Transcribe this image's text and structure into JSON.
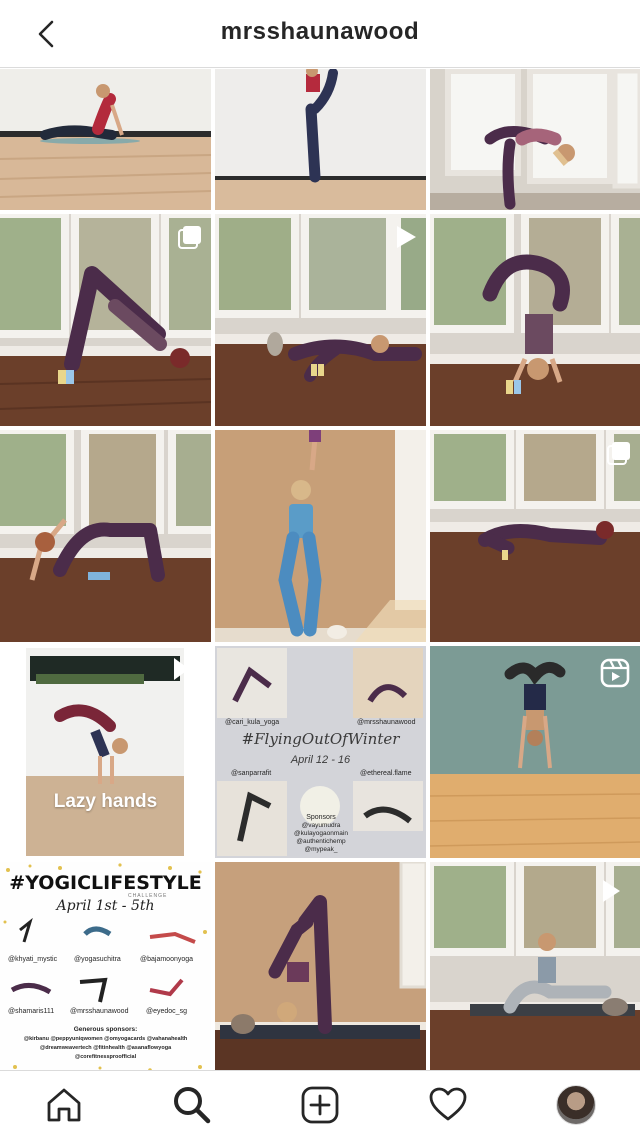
{
  "header": {
    "username": "mrsshaunawood"
  },
  "posts": [
    {
      "alt": "post-1"
    },
    {
      "alt": "post-2"
    },
    {
      "alt": "post-3"
    },
    {
      "alt": "post-4",
      "badge": "carousel"
    },
    {
      "alt": "post-5",
      "badge": "video"
    },
    {
      "alt": "post-6"
    },
    {
      "alt": "post-7"
    },
    {
      "alt": "post-8"
    },
    {
      "alt": "post-9",
      "badge": "carousel"
    },
    {
      "alt": "post-10",
      "badge": "video"
    },
    {
      "alt": "post-11"
    },
    {
      "alt": "post-12",
      "badge": "reel"
    },
    {
      "alt": "post-13"
    },
    {
      "alt": "post-14"
    },
    {
      "alt": "post-15",
      "badge": "video"
    }
  ],
  "post10": {
    "caption": "Lazy hands"
  },
  "post11": {
    "hashtag": "#FlyingOutOfWinter",
    "dates": "April 12 - 16",
    "handles": [
      "@cari_kula_yoga",
      "@mrsshaunawood",
      "@sanparrafit",
      "@ethereal.flame"
    ],
    "sponsors_title": "Sponsors",
    "sponsors": [
      "@vayumudra",
      "@kulayogaonmain",
      "@authentichemp",
      "@mypeak_"
    ]
  },
  "post13": {
    "title": "#YOGICLIFESTYLE",
    "subtitle": "CHALLENGE",
    "dates": "April 1st - 5th",
    "handles": [
      "@khyati_mystic",
      "@yogasuchitra",
      "@bajamoonyoga",
      "@shamaris111",
      "@mrsshaunawood",
      "@eyedoc_sg"
    ],
    "sponsors_title": "Generous sponsors:",
    "sponsors_line1": "@kirbanu @peppyuniqwomen @omyogacards @vahanahealth",
    "sponsors_line2": "@dreamweavertech @fitinhealth @asanaflowyoga",
    "sponsors_line3": "@corefitnessproofficial"
  },
  "tabbar": {
    "items": [
      "home",
      "search",
      "create",
      "activity",
      "profile"
    ]
  }
}
